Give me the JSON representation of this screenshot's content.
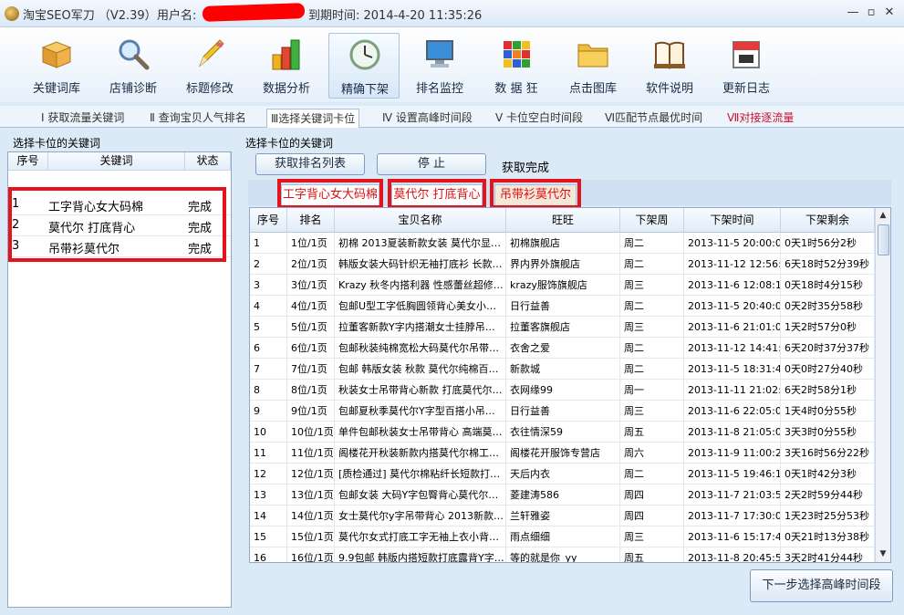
{
  "window": {
    "app_title": "淘宝SEO军刀 （V2.39）",
    "user_label": "用户名:",
    "expire_label": "到期时间: 2014-4-20 11:35:26",
    "controls": {
      "minimize": "—",
      "restore": "▫",
      "close": "✕"
    }
  },
  "toolbar": [
    {
      "label": "关键词库",
      "icon": "box-icon"
    },
    {
      "label": "店铺诊断",
      "icon": "magnifier-icon"
    },
    {
      "label": "标题修改",
      "icon": "pencil-icon"
    },
    {
      "label": "数据分析",
      "icon": "bar-chart-icon"
    },
    {
      "label": "精确下架",
      "icon": "clock-icon"
    },
    {
      "label": "排名监控",
      "icon": "monitor-icon"
    },
    {
      "label": "数 据 狂",
      "icon": "rubik-cube-icon"
    },
    {
      "label": "点击图库",
      "icon": "folder-icon"
    },
    {
      "label": "软件说明",
      "icon": "book-icon"
    },
    {
      "label": "更新日志",
      "icon": "calendar-icon"
    }
  ],
  "steps": [
    "Ⅰ 获取流量关键词",
    "Ⅱ 查询宝贝人气排名",
    "Ⅲ选择关键词卡位",
    "Ⅳ 设置高峰时间段",
    "Ⅴ 卡位空白时间段",
    "Ⅵ匹配节点最优时间",
    "Ⅶ对接逐流量"
  ],
  "left_panel": {
    "title": "选择卡位的关键词",
    "headers": [
      "序号",
      "关键词",
      "状态"
    ],
    "rows": [
      [
        "1",
        "工字背心女大码棉",
        "完成"
      ],
      [
        "2",
        "莫代尔 打底背心",
        "完成"
      ],
      [
        "3",
        "吊带衫莫代尔",
        "完成"
      ]
    ]
  },
  "right_panel": {
    "title": "选择卡位的关键词",
    "get_rank_button": "获取排名列表",
    "stop_button": "停  止",
    "status": "获取完成",
    "keyword_tabs": [
      "工字背心女大码棉",
      "莫代尔 打底背心",
      "吊带衫莫代尔"
    ],
    "headers": [
      "序号",
      "排名",
      "宝贝名称",
      "旺旺",
      "下架周",
      "下架时间",
      "下架剩余"
    ],
    "rows": [
      [
        "1",
        "1位/1页",
        "初棉 2013夏装新款女装 莫代尔显…",
        "初棉旗舰店",
        "周二",
        "2013-11-5 20:00:00",
        "0天1时56分2秒"
      ],
      [
        "2",
        "2位/1页",
        "韩版女装大码针织无袖打底衫 长款…",
        "界内界外旗舰店",
        "周二",
        "2013-11-12  12:56:…",
        "6天18时52分39秒"
      ],
      [
        "3",
        "3位/1页",
        "Krazy  秋冬内搭利器 性感蕾丝超修…",
        "krazy服饰旗舰店",
        "周三",
        "2013-11-6 12:08:17",
        "0天18时4分15秒"
      ],
      [
        "4",
        "4位/1页",
        "包邮U型工字低胸圆领背心美女小…",
        "日行益善",
        "周二",
        "2013-11-5 20:40:00",
        "0天2时35分58秒"
      ],
      [
        "5",
        "5位/1页",
        "拉董客新款Y字内搭潮女士挂脖吊…",
        "拉董客旗舰店",
        "周三",
        "2013-11-6 21:01:03",
        "1天2时57分0秒"
      ],
      [
        "6",
        "6位/1页",
        "包邮秋装纯棉宽松大码莫代尔吊带…",
        "衣舍之爱",
        "周二",
        "2013-11-12  14:41:…",
        "6天20时37分37秒"
      ],
      [
        "7",
        "7位/1页",
        "包邮 韩版女装 秋款 莫代尔纯棉百…",
        "新款城",
        "周二",
        "2013-11-5 18:31:44",
        "0天0时27分40秒"
      ],
      [
        "8",
        "8位/1页",
        "秋装女士吊带背心新款 打底莫代尔…",
        "衣网缘99",
        "周一",
        "2013-11-11  21:02:…",
        "6天2时58分1秒"
      ],
      [
        "9",
        "9位/1页",
        "包邮夏秋季莫代尔Y字型百搭小吊…",
        "日行益善",
        "周三",
        "2013-11-6 22:05:00",
        "1天4时0分55秒"
      ],
      [
        "10",
        "10位/1页",
        "单件包邮秋装女士吊带背心 高端莫…",
        "衣往情深59",
        "周五",
        "2013-11-8 21:05:00",
        "3天3时0分55秒"
      ],
      [
        "11",
        "11位/1页",
        "阁楼花开秋装新款内搭莫代尔棉工…",
        "阁楼花开服饰专营店",
        "周六",
        "2013-11-9 11:00:28",
        "3天16时56分22秒"
      ],
      [
        "12",
        "12位/1页",
        "[质检通过] 莫代尔棉粘纤长短款打…",
        "天后内衣",
        "周二",
        "2013-11-5 19:46:10",
        "0天1时42分3秒"
      ],
      [
        "13",
        "13位/1页",
        "包邮女装 大码Y字包臀背心莫代尔…",
        "菱建涛586",
        "周四",
        "2013-11-7 21:03:51",
        "2天2时59分44秒"
      ],
      [
        "14",
        "14位/1页",
        "女士莫代尔y字吊带背心 2013新款…",
        "兰轩雅姿",
        "周四",
        "2013-11-7 17:30:00",
        "1天23时25分53秒"
      ],
      [
        "15",
        "15位/1页",
        "莫代尔女式打底工字无袖上衣小背…",
        "雨点细细",
        "周三",
        "2013-11-6 15:17:46",
        "0天21时13分38秒"
      ],
      [
        "16",
        "16位/1页",
        "9.9包邮 韩版内搭短款打底露背Y字…",
        "等的就是你_yy",
        "周五",
        "2013-11-8 20:45:52",
        "3天2时41分44秒"
      ]
    ],
    "next_button": "下一步选择高峰时间段"
  }
}
